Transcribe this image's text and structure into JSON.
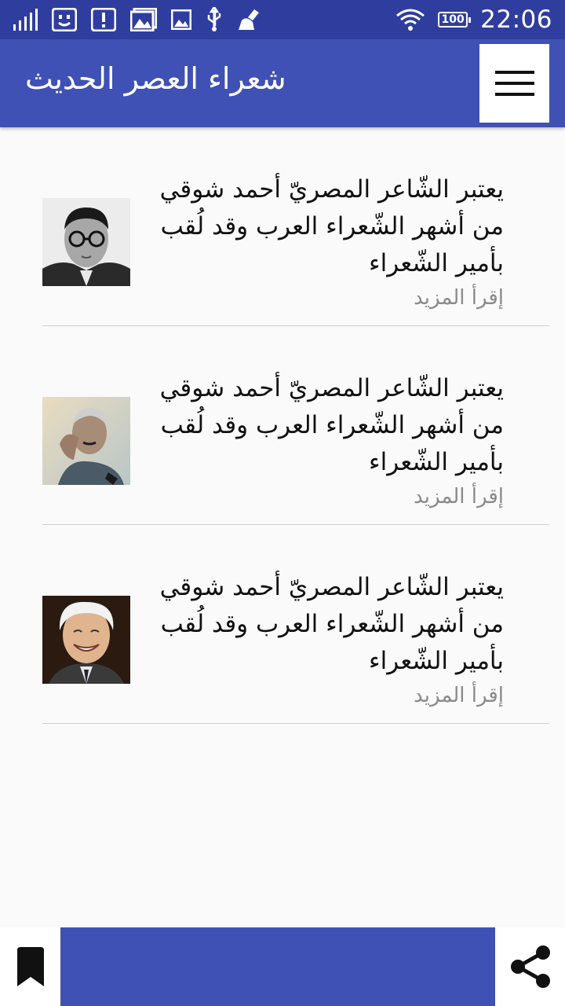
{
  "status_bar": {
    "time": "22:06",
    "battery": "100",
    "icons_left": [
      "signal-icon",
      "face-notification-icon",
      "alert-icon",
      "gallery-icon",
      "image-icon",
      "usb-icon",
      "cleaner-icon"
    ],
    "icons_right": [
      "wifi-icon",
      "battery-icon"
    ]
  },
  "app_bar": {
    "title": "شعراء العصر الحديث",
    "menu_icon": "hamburger-menu-icon",
    "color": "#3f51b5"
  },
  "poets": [
    {
      "text": "يعتبر الشّاعر المصريّ أحمد شوقي من أشهر الشّعراء العرب وقد لُقب بأمير الشّعراء",
      "more": "إقرأ المزيد",
      "photo": "poet-portrait-glasses"
    },
    {
      "text": "يعتبر الشّاعر المصريّ أحمد شوقي من أشهر الشّعراء العرب وقد لُقب بأمير الشّعراء",
      "more": "إقرأ المزيد",
      "photo": "poet-portrait-thinking"
    },
    {
      "text": "يعتبر الشّاعر المصريّ أحمد شوقي من أشهر الشّعراء العرب وقد لُقب بأمير الشّعراء",
      "more": "إقرأ المزيد",
      "photo": "poet-portrait-smiling"
    }
  ],
  "bottom_bar": {
    "bookmark_icon": "bookmark-icon",
    "share_icon": "share-icon"
  }
}
